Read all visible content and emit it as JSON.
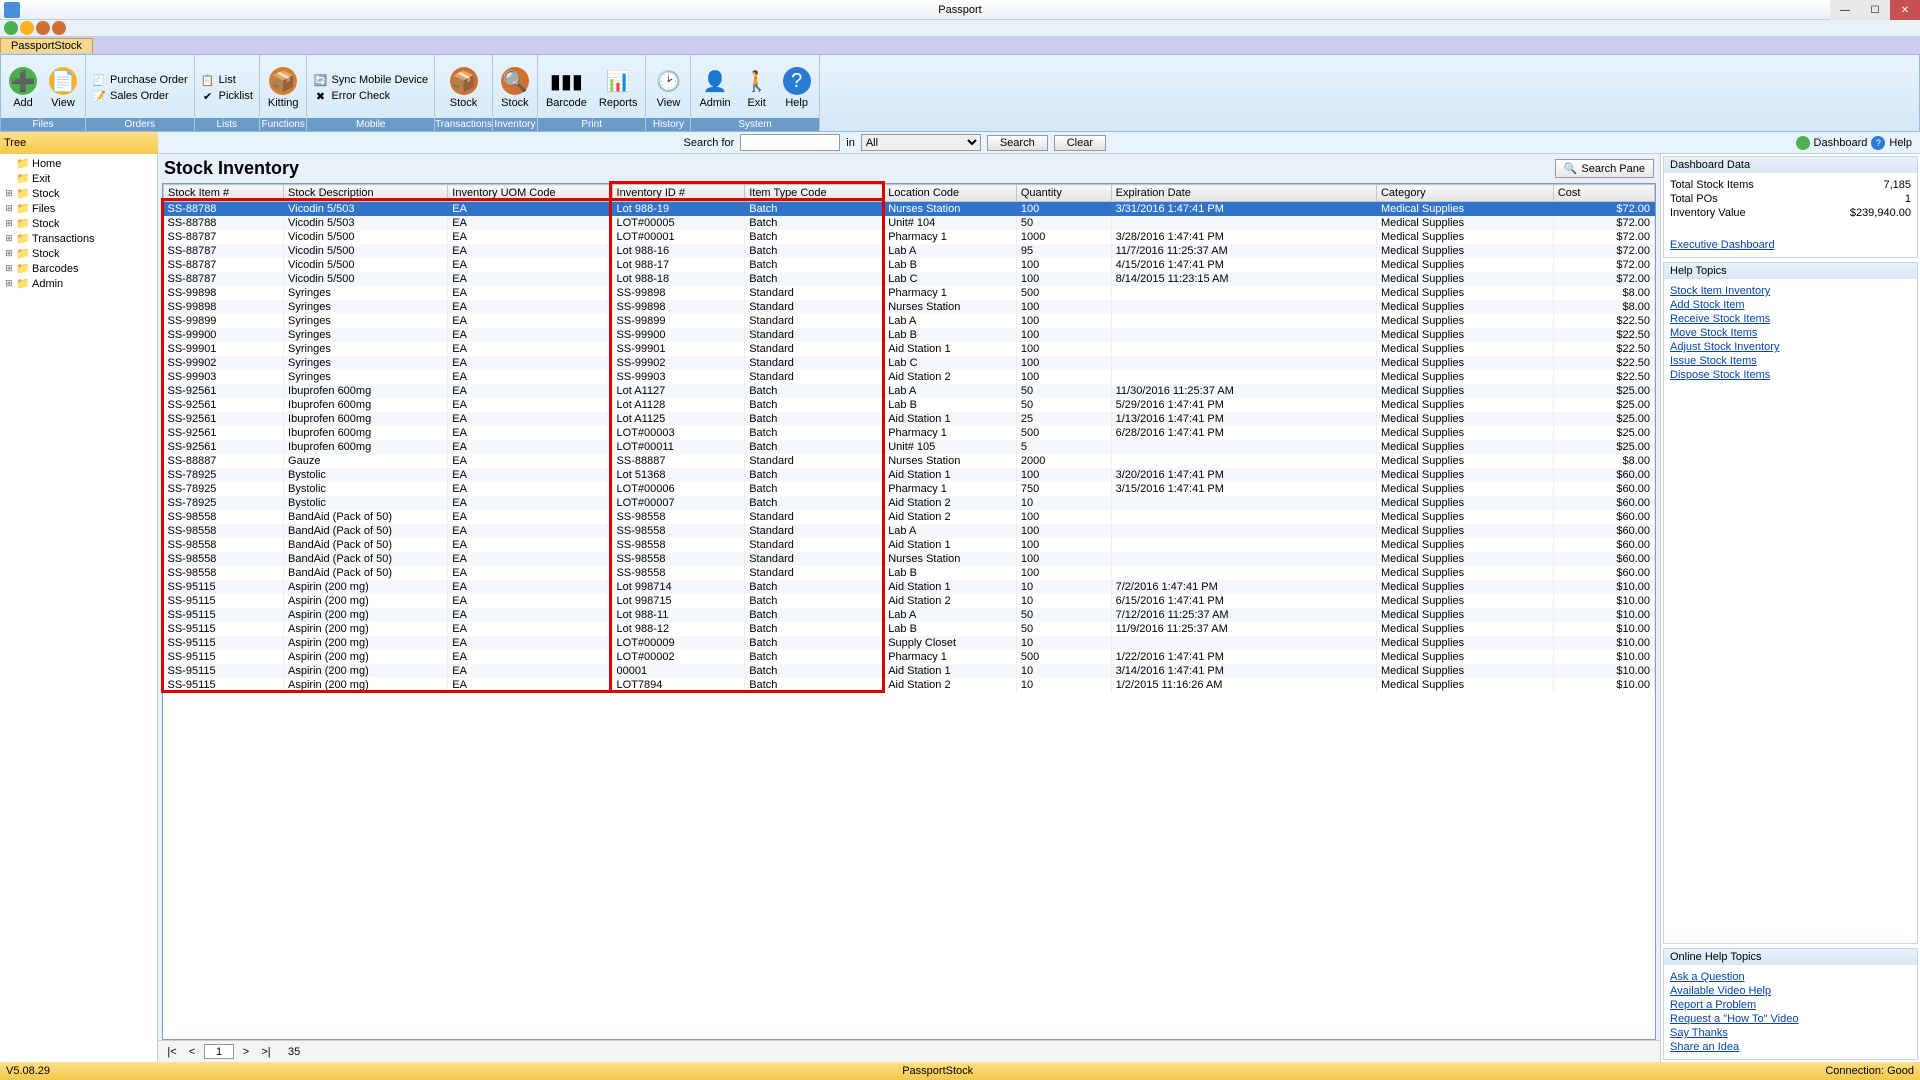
{
  "window": {
    "title": "Passport",
    "doc_tab": "PassportStock"
  },
  "ribbon": {
    "groups": [
      {
        "title": "Files",
        "bigs": [
          {
            "name": "add",
            "label": "Add",
            "glyph": "➕",
            "bg": "#4CAF50"
          },
          {
            "name": "view",
            "label": "View",
            "glyph": "📄",
            "bg": "#FFB020"
          }
        ],
        "subs": []
      },
      {
        "title": "Orders",
        "bigs": [],
        "subs": [
          {
            "name": "purchase-order",
            "label": "Purchase Order",
            "glyph": "🧾"
          },
          {
            "name": "sales-order",
            "label": "Sales Order",
            "glyph": "📝"
          }
        ]
      },
      {
        "title": "Lists",
        "bigs": [],
        "subs": [
          {
            "name": "list",
            "label": "List",
            "glyph": "📋"
          },
          {
            "name": "picklist",
            "label": "Picklist",
            "glyph": "✔"
          }
        ]
      },
      {
        "title": "Functions",
        "bigs": [
          {
            "name": "kitting",
            "label": "Kitting",
            "glyph": "📦",
            "bg": "#d08030"
          }
        ],
        "subs": []
      },
      {
        "title": "Mobile",
        "bigs": [],
        "subs": [
          {
            "name": "sync",
            "label": "Sync Mobile Device",
            "glyph": "🔄"
          },
          {
            "name": "error-check",
            "label": "Error Check",
            "glyph": "✖"
          }
        ]
      },
      {
        "title": "Transactions",
        "bigs": [
          {
            "name": "stock-trans",
            "label": "Stock",
            "glyph": "📦",
            "bg": "#d07030"
          }
        ],
        "subs": []
      },
      {
        "title": "Inventory",
        "bigs": [
          {
            "name": "stock-inv",
            "label": "Stock",
            "glyph": "🔍",
            "bg": "#d07030"
          }
        ],
        "subs": []
      },
      {
        "title": "Print",
        "bigs": [
          {
            "name": "barcode",
            "label": "Barcode",
            "glyph": "▮▮▮",
            "bg": ""
          },
          {
            "name": "reports",
            "label": "Reports",
            "glyph": "📊",
            "bg": ""
          }
        ],
        "subs": []
      },
      {
        "title": "History",
        "bigs": [
          {
            "name": "view-hist",
            "label": "View",
            "glyph": "🕑",
            "bg": ""
          }
        ],
        "subs": []
      },
      {
        "title": "System",
        "bigs": [
          {
            "name": "admin",
            "label": "Admin",
            "glyph": "👤",
            "bg": ""
          },
          {
            "name": "exit",
            "label": "Exit",
            "glyph": "🚶",
            "bg": ""
          },
          {
            "name": "help",
            "label": "Help",
            "glyph": "?",
            "bg": "#2a7bd4"
          }
        ],
        "subs": []
      }
    ]
  },
  "search": {
    "search_for": "Search for",
    "in": "in",
    "all": "All",
    "search_btn": "Search",
    "clear_btn": "Clear",
    "dashboard": "Dashboard",
    "help": "Help"
  },
  "tree": {
    "title": "Tree",
    "items": [
      {
        "label": "Home",
        "expander": "",
        "icon": "📁"
      },
      {
        "label": "Exit",
        "expander": "",
        "icon": "📁"
      },
      {
        "label": "Stock",
        "expander": "⊞",
        "icon": "📁"
      },
      {
        "label": "Files",
        "expander": "⊞",
        "icon": "📁"
      },
      {
        "label": "Stock",
        "expander": "⊞",
        "icon": "📁"
      },
      {
        "label": "Transactions",
        "expander": "⊞",
        "icon": "📁"
      },
      {
        "label": "Stock",
        "expander": "⊞",
        "icon": "📁"
      },
      {
        "label": "Barcodes",
        "expander": "⊞",
        "icon": "📁"
      },
      {
        "label": "Admin",
        "expander": "⊞",
        "icon": "📁"
      }
    ]
  },
  "page": {
    "title": "Stock Inventory",
    "search_pane": "Search Pane"
  },
  "columns": [
    "Stock Item #",
    "Stock Description",
    "Inventory UOM Code",
    "Inventory ID #",
    "Item Type Code",
    "Location Code",
    "Quantity",
    "Expiration Date",
    "Category",
    "Cost"
  ],
  "rows": [
    [
      "SS-88788",
      "Vicodin 5/503",
      "EA",
      "Lot 988-19",
      "Batch",
      "Nurses Station",
      "100",
      "3/31/2016 1:47:41 PM",
      "Medical Supplies",
      "$72.00"
    ],
    [
      "SS-88788",
      "Vicodin 5/503",
      "EA",
      "LOT#00005",
      "Batch",
      "Unit# 104",
      "50",
      "",
      "Medical Supplies",
      "$72.00"
    ],
    [
      "SS-88787",
      "Vicodin 5/500",
      "EA",
      "LOT#00001",
      "Batch",
      "Pharmacy 1",
      "1000",
      "3/28/2016 1:47:41 PM",
      "Medical Supplies",
      "$72.00"
    ],
    [
      "SS-88787",
      "Vicodin 5/500",
      "EA",
      "Lot 988-16",
      "Batch",
      "Lab A",
      "95",
      "11/7/2016 11:25:37 AM",
      "Medical Supplies",
      "$72.00"
    ],
    [
      "SS-88787",
      "Vicodin 5/500",
      "EA",
      "Lot 988-17",
      "Batch",
      "Lab B",
      "100",
      "4/15/2016 1:47:41 PM",
      "Medical Supplies",
      "$72.00"
    ],
    [
      "SS-88787",
      "Vicodin 5/500",
      "EA",
      "Lot 988-18",
      "Batch",
      "Lab C",
      "100",
      "8/14/2015 11:23:15 AM",
      "Medical Supplies",
      "$72.00"
    ],
    [
      "SS-99898",
      "Syringes",
      "EA",
      "SS-99898",
      "Standard",
      "Pharmacy 1",
      "500",
      "",
      "Medical Supplies",
      "$8.00"
    ],
    [
      "SS-99898",
      "Syringes",
      "EA",
      "SS-99898",
      "Standard",
      "Nurses Station",
      "100",
      "",
      "Medical Supplies",
      "$8.00"
    ],
    [
      "SS-99899",
      "Syringes",
      "EA",
      "SS-99899",
      "Standard",
      "Lab A",
      "100",
      "",
      "Medical Supplies",
      "$22.50"
    ],
    [
      "SS-99900",
      "Syringes",
      "EA",
      "SS-99900",
      "Standard",
      "Lab B",
      "100",
      "",
      "Medical Supplies",
      "$22.50"
    ],
    [
      "SS-99901",
      "Syringes",
      "EA",
      "SS-99901",
      "Standard",
      "Aid Station 1",
      "100",
      "",
      "Medical Supplies",
      "$22.50"
    ],
    [
      "SS-99902",
      "Syringes",
      "EA",
      "SS-99902",
      "Standard",
      "Lab C",
      "100",
      "",
      "Medical Supplies",
      "$22.50"
    ],
    [
      "SS-99903",
      "Syringes",
      "EA",
      "SS-99903",
      "Standard",
      "Aid Station 2",
      "100",
      "",
      "Medical Supplies",
      "$22.50"
    ],
    [
      "SS-92561",
      "Ibuprofen 600mg",
      "EA",
      "Lot A1127",
      "Batch",
      "Lab A",
      "50",
      "11/30/2016 11:25:37 AM",
      "Medical Supplies",
      "$25.00"
    ],
    [
      "SS-92561",
      "Ibuprofen 600mg",
      "EA",
      "Lot A1128",
      "Batch",
      "Lab B",
      "50",
      "5/29/2016 1:47:41 PM",
      "Medical Supplies",
      "$25.00"
    ],
    [
      "SS-92561",
      "Ibuprofen 600mg",
      "EA",
      "Lot A1125",
      "Batch",
      "Aid Station 1",
      "25",
      "1/13/2016 1:47:41 PM",
      "Medical Supplies",
      "$25.00"
    ],
    [
      "SS-92561",
      "Ibuprofen 600mg",
      "EA",
      "LOT#00003",
      "Batch",
      "Pharmacy 1",
      "500",
      "6/28/2016 1:47:41 PM",
      "Medical Supplies",
      "$25.00"
    ],
    [
      "SS-92561",
      "Ibuprofen 600mg",
      "EA",
      "LOT#00011",
      "Batch",
      "Unit# 105",
      "5",
      "",
      "Medical Supplies",
      "$25.00"
    ],
    [
      "SS-88887",
      "Gauze",
      "EA",
      "SS-88887",
      "Standard",
      "Nurses Station",
      "2000",
      "",
      "Medical Supplies",
      "$8.00"
    ],
    [
      "SS-78925",
      "Bystolic",
      "EA",
      "Lot 51368",
      "Batch",
      "Aid Station 1",
      "100",
      "3/20/2016 1:47:41 PM",
      "Medical Supplies",
      "$60.00"
    ],
    [
      "SS-78925",
      "Bystolic",
      "EA",
      "LOT#00006",
      "Batch",
      "Pharmacy 1",
      "750",
      "3/15/2016 1:47:41 PM",
      "Medical Supplies",
      "$60.00"
    ],
    [
      "SS-78925",
      "Bystolic",
      "EA",
      "LOT#00007",
      "Batch",
      "Aid Station 2",
      "10",
      "",
      "Medical Supplies",
      "$60.00"
    ],
    [
      "SS-98558",
      "BandAid (Pack of 50)",
      "EA",
      "SS-98558",
      "Standard",
      "Aid Station 2",
      "100",
      "",
      "Medical Supplies",
      "$60.00"
    ],
    [
      "SS-98558",
      "BandAid (Pack of 50)",
      "EA",
      "SS-98558",
      "Standard",
      "Lab A",
      "100",
      "",
      "Medical Supplies",
      "$60.00"
    ],
    [
      "SS-98558",
      "BandAid (Pack of 50)",
      "EA",
      "SS-98558",
      "Standard",
      "Aid Station 1",
      "100",
      "",
      "Medical Supplies",
      "$60.00"
    ],
    [
      "SS-98558",
      "BandAid (Pack of 50)",
      "EA",
      "SS-98558",
      "Standard",
      "Nurses Station",
      "100",
      "",
      "Medical Supplies",
      "$60.00"
    ],
    [
      "SS-98558",
      "BandAid (Pack of 50)",
      "EA",
      "SS-98558",
      "Standard",
      "Lab B",
      "100",
      "",
      "Medical Supplies",
      "$60.00"
    ],
    [
      "SS-95115",
      "Aspirin (200 mg)",
      "EA",
      "Lot 998714",
      "Batch",
      "Aid Station 1",
      "10",
      "7/2/2016 1:47:41 PM",
      "Medical Supplies",
      "$10.00"
    ],
    [
      "SS-95115",
      "Aspirin (200 mg)",
      "EA",
      "Lot 998715",
      "Batch",
      "Aid Station 2",
      "10",
      "6/15/2016 1:47:41 PM",
      "Medical Supplies",
      "$10.00"
    ],
    [
      "SS-95115",
      "Aspirin (200 mg)",
      "EA",
      "Lot 988-11",
      "Batch",
      "Lab A",
      "50",
      "7/12/2016 11:25:37 AM",
      "Medical Supplies",
      "$10.00"
    ],
    [
      "SS-95115",
      "Aspirin (200 mg)",
      "EA",
      "Lot 988-12",
      "Batch",
      "Lab B",
      "50",
      "11/9/2016 11:25:37 AM",
      "Medical Supplies",
      "$10.00"
    ],
    [
      "SS-95115",
      "Aspirin (200 mg)",
      "EA",
      "LOT#00009",
      "Batch",
      "Supply Closet",
      "10",
      "",
      "Medical Supplies",
      "$10.00"
    ],
    [
      "SS-95115",
      "Aspirin (200 mg)",
      "EA",
      "LOT#00002",
      "Batch",
      "Pharmacy 1",
      "500",
      "1/22/2016 1:47:41 PM",
      "Medical Supplies",
      "$10.00"
    ],
    [
      "SS-95115",
      "Aspirin (200 mg)",
      "EA",
      "00001",
      "Batch",
      "Aid Station 1",
      "10",
      "3/14/2016 1:47:41 PM",
      "Medical Supplies",
      "$10.00"
    ],
    [
      "SS-95115",
      "Aspirin (200 mg)",
      "EA",
      "LOT7894",
      "Batch",
      "Aid Station 2",
      "10",
      "1/2/2015 11:16:26 AM",
      "Medical Supplies",
      "$10.00"
    ]
  ],
  "pager": {
    "page": "1",
    "total": "35"
  },
  "dashboard": {
    "title": "Dashboard Data",
    "items": [
      {
        "k": "Total Stock Items",
        "v": "7,185"
      },
      {
        "k": "Total POs",
        "v": "1"
      },
      {
        "k": "Inventory Value",
        "v": "$239,940.00"
      }
    ],
    "exec_link": "Executive Dashboard"
  },
  "help_topics": {
    "title": "Help Topics",
    "links": [
      "Stock Item Inventory",
      "Add Stock Item",
      "Receive Stock Items",
      "Move Stock Items",
      "Adjust Stock Inventory",
      "Issue Stock Items",
      "Dispose Stock Items"
    ]
  },
  "online_help": {
    "title": "Online Help Topics",
    "links": [
      "Ask a Question",
      "Available Video Help",
      "Report a Problem",
      "Request a \"How To\" Video",
      "Say Thanks",
      "Share an Idea"
    ]
  },
  "status": {
    "version": "V5.08.29",
    "center": "PassportStock",
    "conn": "Connection: Good"
  }
}
